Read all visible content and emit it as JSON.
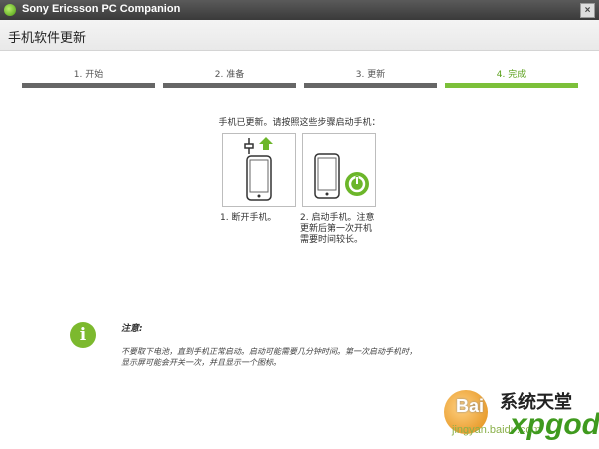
{
  "window": {
    "title": "Sony Ericsson PC Companion",
    "close_symbol": "×"
  },
  "header": {
    "title": "手机软件更新"
  },
  "steps": [
    {
      "label": "1. 开始",
      "status": "done"
    },
    {
      "label": "2. 准备",
      "status": "done"
    },
    {
      "label": "3. 更新",
      "status": "done"
    },
    {
      "label": "4. 完成",
      "status": "active"
    }
  ],
  "main": {
    "instruction": "手机已更新。请按照这些步骤启动手机：",
    "step_captions": [
      "1. 断开手机。",
      "2. 启动手机。注意更新后第一次开机需要时间较长。"
    ]
  },
  "note": {
    "icon_symbol": "i",
    "title": "注意:",
    "text": "不要取下电池，直到手机正常启动。启动可能需要几分钟时间。第一次启动手机时，显示屏可能会开关一次，并且显示一个图标。"
  },
  "watermark": {
    "baidu": "Bai",
    "cn": "系统天堂",
    "url": "jingyan.baidu.com",
    "logo": "xpgod"
  },
  "colors": {
    "accent": "#7cc03a",
    "bar_done": "#666666",
    "note_icon": "#7cb92e"
  }
}
